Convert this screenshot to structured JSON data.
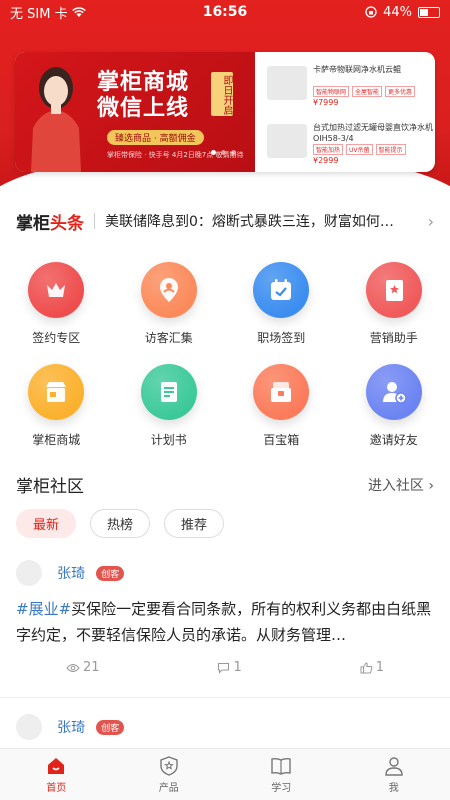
{
  "status": {
    "carrier": "无 SIM 卡",
    "time": "16:56",
    "battery": "44%",
    "battery_level": 0.44
  },
  "banner": {
    "title_line1": "掌柜商城",
    "title_line2": "微信上线",
    "tag": "即日开启",
    "pill": "臻选商品 · 高额佣金",
    "note": "掌柜带保险 · 快手号 4月2日晚7点 敬请期待",
    "products": [
      {
        "name": "卡萨帝物联网净水机云鲲",
        "tags": [
          "智能物联网",
          "全屋智能",
          "更多优惠"
        ],
        "price": "¥7999"
      },
      {
        "name": "台式加热过滤无罐母婴直饮净水机 OIH58-3/4",
        "tags": [
          "智能加热",
          "UV杀菌",
          "智能提示"
        ],
        "price": "¥2999"
      }
    ]
  },
  "headline": {
    "brand_a": "掌柜",
    "brand_b": "头条",
    "text": "美联储降息到0：熔断式暴跌三连，财富如何…"
  },
  "grid": [
    {
      "label": "签约专区",
      "icon": "crown-icon",
      "color": "#ef4d4d"
    },
    {
      "label": "访客汇集",
      "icon": "visitor-pin-icon",
      "color": "#fb8a5a"
    },
    {
      "label": "职场签到",
      "icon": "calendar-check-icon",
      "color": "#3b8df0"
    },
    {
      "label": "营销助手",
      "icon": "book-star-icon",
      "color": "#f05a5a"
    },
    {
      "label": "掌柜商城",
      "icon": "store-icon",
      "color": "#fbb12e"
    },
    {
      "label": "计划书",
      "icon": "document-icon",
      "color": "#3cc99a"
    },
    {
      "label": "百宝箱",
      "icon": "treasure-box-icon",
      "color": "#fb7b5a"
    },
    {
      "label": "邀请好友",
      "icon": "add-friend-icon",
      "color": "#6c84f2"
    }
  ],
  "community": {
    "title": "掌柜社区",
    "enter": "进入社区",
    "tabs": [
      "最新",
      "热榜",
      "推荐"
    ],
    "posts": [
      {
        "user": "张琦",
        "badge": "创客",
        "topic": "#展业#",
        "text": "买保险一定要看合同条款，所有的权利义务都由白纸黑字约定，不要轻信保险人员的承诺。从财务管理…",
        "views": "21",
        "comments": "1",
        "likes": "1"
      },
      {
        "user": "张琦",
        "badge": "创客"
      }
    ]
  },
  "tabbar": [
    "首页",
    "产品",
    "学习",
    "我"
  ]
}
